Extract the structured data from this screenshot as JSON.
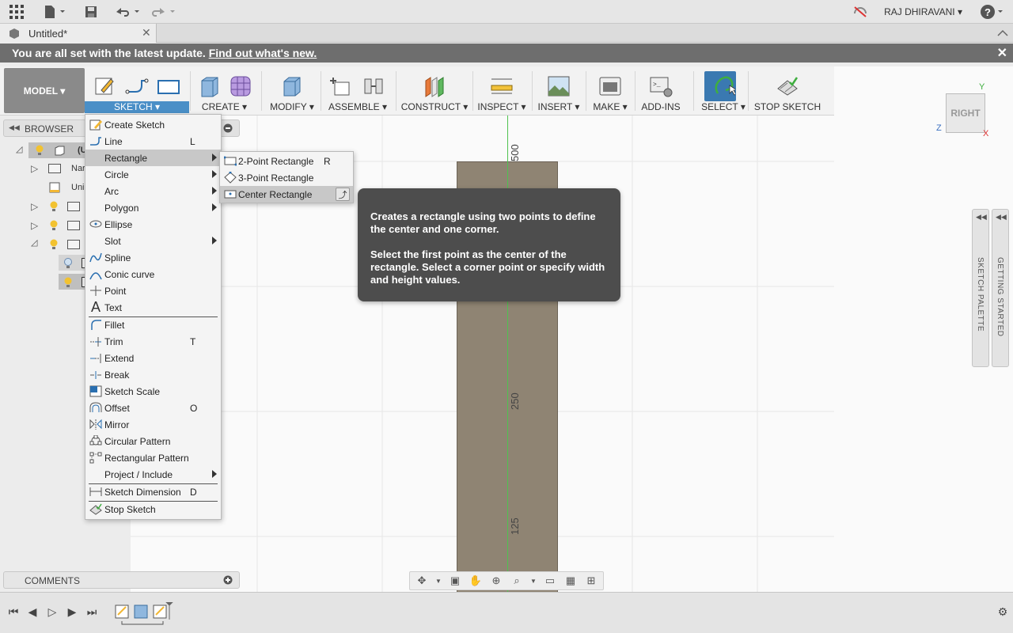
{
  "appbar": {
    "user_name": "RAJ DHIRAVANI ▾",
    "icons": [
      "apps-grid-icon",
      "file-icon",
      "save-icon",
      "undo-icon",
      "redo-icon",
      "offline-icon",
      "help-icon"
    ]
  },
  "tab": {
    "title": "Untitled*",
    "close": "✕"
  },
  "banner": {
    "text": "You are all set with the latest update.",
    "link": "Find out what's new.",
    "close": "✕"
  },
  "ribbon": {
    "workspace": "MODEL ▾",
    "groups": {
      "sketch": "SKETCH ▾",
      "create": "CREATE ▾",
      "modify": "MODIFY ▾",
      "assemble": "ASSEMBLE ▾",
      "construct": "CONSTRUCT ▾",
      "inspect": "INSPECT ▾",
      "insert": "INSERT ▾",
      "make": "MAKE ▾",
      "addins": "ADD-INS",
      "select": "SELECT ▾",
      "stop_sketch": "STOP SKETCH"
    }
  },
  "browser": {
    "title": "BROWSER",
    "rows": {
      "row1": "(U",
      "row2": "Nar",
      "row3": "Uni"
    }
  },
  "comments": {
    "title": "COMMENTS"
  },
  "viewport": {
    "dims": {
      "d500": "500",
      "d250": "250",
      "d125": "125"
    }
  },
  "viewcube": {
    "face": "RIGHT",
    "y": "Y",
    "z": "Z",
    "x": "X"
  },
  "side_palettes": {
    "sketch_palette": "SKETCH PALETTE",
    "getting_started": "GETTING STARTED"
  },
  "sketch_menu": {
    "items": [
      {
        "label": "Create Sketch",
        "shortcut": "",
        "icon": "create-sketch-icon"
      },
      {
        "label": "Line",
        "shortcut": "L",
        "icon": "line-icon"
      },
      {
        "label": "Rectangle",
        "shortcut": "",
        "icon": "",
        "submenu": true
      },
      {
        "label": "Circle",
        "shortcut": "",
        "icon": "",
        "submenu": true
      },
      {
        "label": "Arc",
        "shortcut": "",
        "icon": "",
        "submenu": true
      },
      {
        "label": "Polygon",
        "shortcut": "",
        "icon": "",
        "submenu": true
      },
      {
        "label": "Ellipse",
        "shortcut": "",
        "icon": "ellipse-icon"
      },
      {
        "label": "Slot",
        "shortcut": "",
        "icon": "",
        "submenu": true
      },
      {
        "label": "Spline",
        "shortcut": "",
        "icon": "spline-icon"
      },
      {
        "label": "Conic curve",
        "shortcut": "",
        "icon": "conic-curve-icon"
      },
      {
        "label": "Point",
        "shortcut": "",
        "icon": "point-icon"
      },
      {
        "label": "Text",
        "shortcut": "",
        "icon": "text-icon"
      },
      {
        "label": "Fillet",
        "shortcut": "",
        "icon": "fillet-icon"
      },
      {
        "label": "Trim",
        "shortcut": "T",
        "icon": "trim-icon"
      },
      {
        "label": "Extend",
        "shortcut": "",
        "icon": "extend-icon"
      },
      {
        "label": "Break",
        "shortcut": "",
        "icon": "break-icon"
      },
      {
        "label": "Sketch Scale",
        "shortcut": "",
        "icon": "sketch-scale-icon"
      },
      {
        "label": "Offset",
        "shortcut": "O",
        "icon": "offset-icon"
      },
      {
        "label": "Mirror",
        "shortcut": "",
        "icon": "mirror-icon"
      },
      {
        "label": "Circular Pattern",
        "shortcut": "",
        "icon": "circular-pattern-icon"
      },
      {
        "label": "Rectangular Pattern",
        "shortcut": "",
        "icon": "rectangular-pattern-icon"
      },
      {
        "label": "Project / Include",
        "shortcut": "",
        "icon": "",
        "submenu": true
      },
      {
        "label": "Sketch Dimension",
        "shortcut": "D",
        "icon": "sketch-dimension-icon"
      },
      {
        "label": "Stop Sketch",
        "shortcut": "",
        "icon": "stop-sketch-icon"
      }
    ]
  },
  "rect_menu": {
    "items": [
      {
        "label": "2-Point Rectangle",
        "shortcut": "R"
      },
      {
        "label": "3-Point Rectangle",
        "shortcut": ""
      },
      {
        "label": "Center Rectangle",
        "shortcut": ""
      }
    ]
  },
  "tooltip": {
    "p1": "Creates a rectangle using two points to define the center and one corner.",
    "p2": "Select the first point as the center of the rectangle. Select a corner point or specify width and height values."
  },
  "colors": {
    "accent": "#4a8fc7",
    "banner": "#6e6e6e",
    "tooltip": "#4d4d4d",
    "body": "#8f8473",
    "axis": "#4fc24f"
  }
}
